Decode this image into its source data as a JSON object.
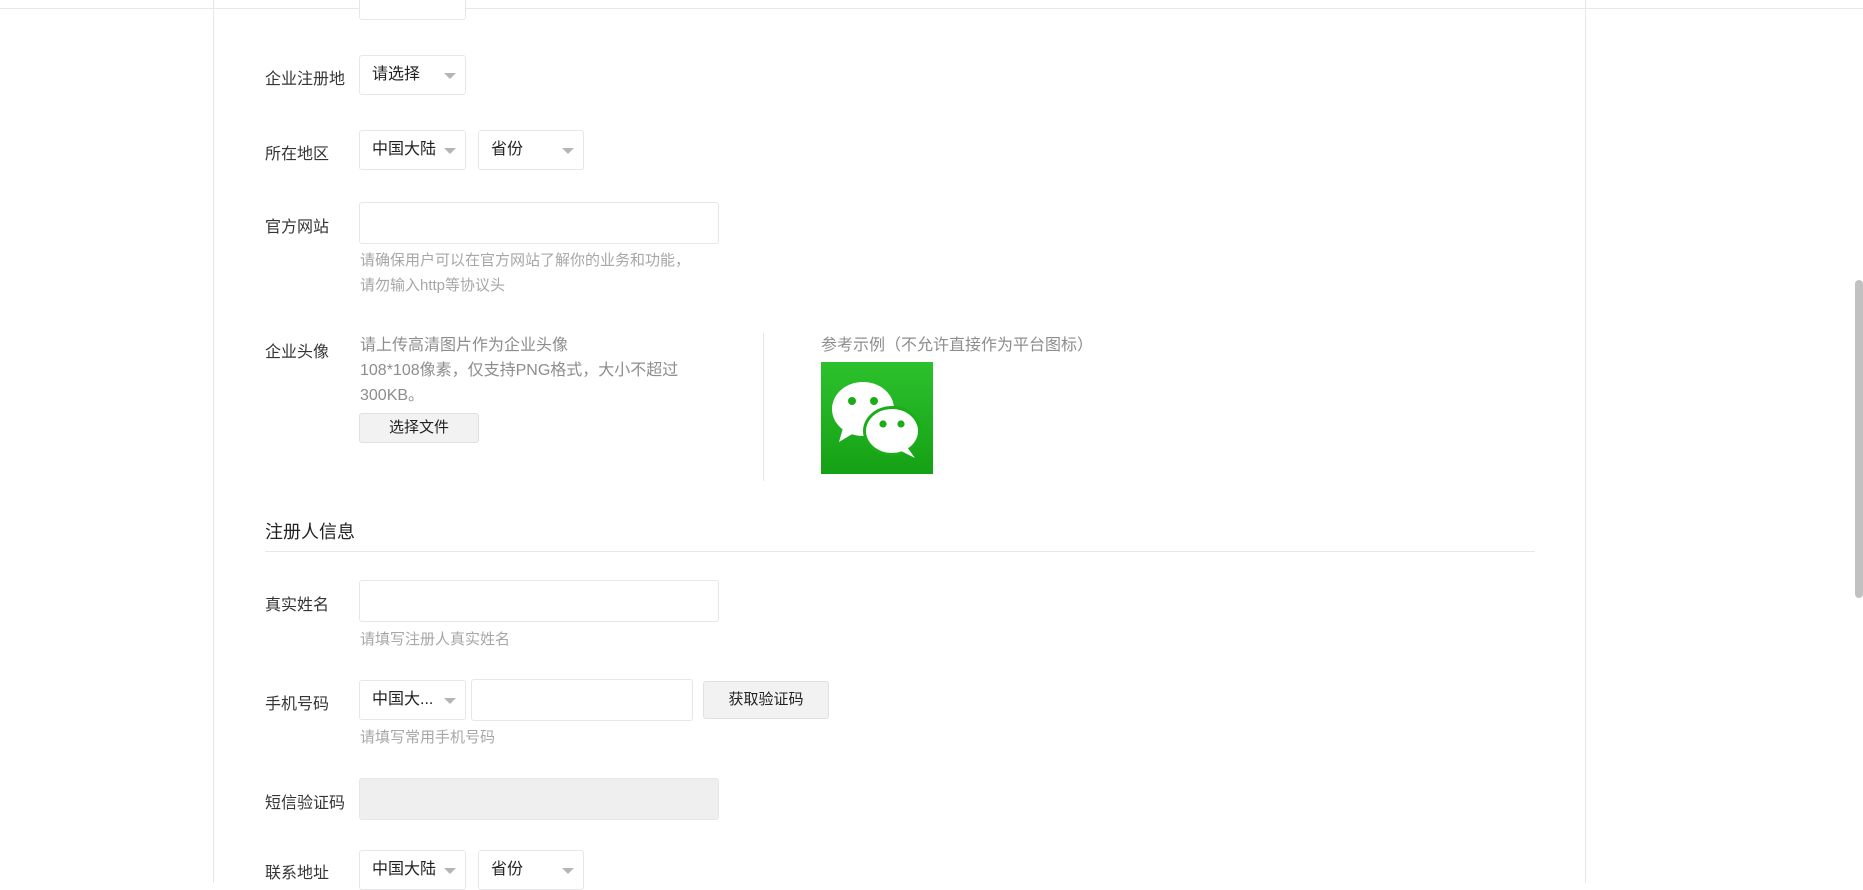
{
  "form": {
    "enterprise_registration": {
      "label": "企业注册地",
      "select_value": "请选择"
    },
    "region": {
      "label": "所在地区",
      "country": "中国大陆",
      "province": "省份"
    },
    "website": {
      "label": "官方网站",
      "value": "",
      "hint_line1": "请确保用户可以在官方网站了解你的业务和功能，",
      "hint_line2": "请勿输入http等协议头"
    },
    "avatar": {
      "label": "企业头像",
      "desc_line1": "请上传高清图片作为企业头像",
      "desc_line2": "108*108像素，仅支持PNG格式，大小不超过",
      "desc_line3": "300KB。",
      "choose_file_label": "选择文件",
      "sample_title": "参考示例（不允许直接作为平台图标）",
      "sample_icon": "wechat-logo"
    }
  },
  "registrant": {
    "section_title": "注册人信息",
    "real_name": {
      "label": "真实姓名",
      "value": "",
      "hint": "请填写注册人真实姓名"
    },
    "phone": {
      "label": "手机号码",
      "country_code": "中国大...",
      "value": "",
      "get_code_label": "获取验证码",
      "hint": "请填写常用手机号码"
    },
    "sms_code": {
      "label": "短信验证码",
      "value": ""
    },
    "address": {
      "label": "联系地址",
      "country": "中国大陆",
      "province": "省份"
    }
  },
  "colors": {
    "wechat_green": "#1aad19",
    "hint_gray": "#a7a7a7"
  }
}
